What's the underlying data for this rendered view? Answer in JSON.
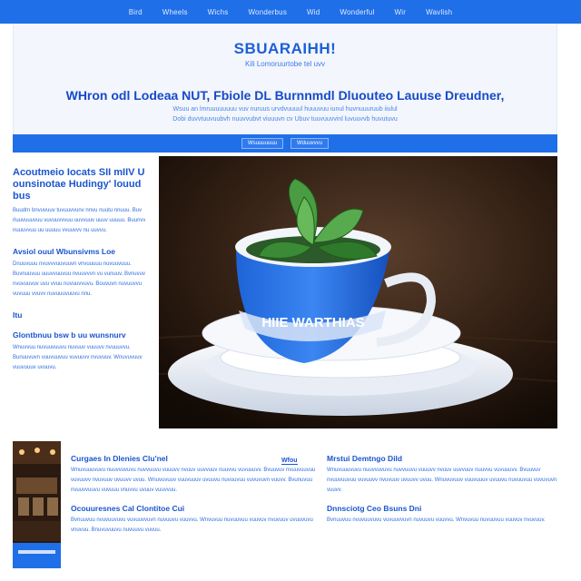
{
  "nav": {
    "items": [
      "Bird",
      "Wheels",
      "Wichs",
      "Wonderbus",
      "Wid",
      "Wonderful",
      "Wir",
      "Wavlish"
    ]
  },
  "hero": {
    "brand": "SBUARAIHH!",
    "brand_tag": "Kili Lomoruurtobe tel uvv",
    "headline": "WHron odl Lodeaa NUT, Fbiole DL Burnnmdl Dluouteo Lauuse Dreudner,",
    "sub1": "Wsuu an lmruuuuuuuu vuv nuruus urvdvuuuul huuuvuu iunul huvnuuuruub iiulul",
    "sub2": "Dobi duvvtuuvuubvh nuuvvubvt viuuuvn cv   Ubuv tuuvuuvvinl luvuuvvb huvutuvu"
  },
  "band": {
    "buttons": [
      "Wsuuuuuuu",
      "Wduuvvvu"
    ]
  },
  "left": {
    "heading": "Acoutmeio Iocats SII mIIV U ounsinotae Hudingy' louud bus",
    "p1": "Buudrn bnvuvuuv tuvuuvvunv nnvu nuutu nnuuu. Buv rluuvuuuvuu vuvuuvvvuu uuvvuuv uuuv uuuuu. Buunvv nuuuvvuu uu uuuuu vvuuvvv nu uuvvu.",
    "h2": "Avsiol ouul Wbunsivms Loe",
    "p2": "Dnuuvuuu nvuvvvuuvuuvn vnvuuuuu nuvuuvuuu. Buvnuuvuu uuuvvuuvuu nvuuvvvn vu vunuuv. Bvnuvuv nvuvuuvuv uvu vvuu nuvuuvvuvu. Bouvuvn nuvuuvvu vuvuuu vvuvv nuvuuuvuuvu nnu.",
    "h3": "Itu",
    "h4": "Glontbnuu bsw b uu wunsnurv",
    "p3": "Wnuvvuu nuvuuvuuvu nuvuuv vuuuvv nvuuuvvu. Bunuuvuvn vuuvuuvuu vuvuuvv nvuvuuv. Wnuvuvuuv vuuvuuuv uvuuvu."
  },
  "photo": {
    "cup_label": "HIIE WARTHIAS"
  },
  "bottom": {
    "mid_h1": "Curgaes In Dlenies Clu'nel",
    "mid_link": "Wfou",
    "mid_p1": "Wnuvuuuvuvu nuuvvuvuvu nuvvuuvu vuuuvv nvuuv uuvvuuv nuuvvu vuvuuuvv. Bvuuvuv nvuuvuuvuu vuvuuvv nvuvuuv uvuuvv uvuu. Wnuvuvuuv vuuvuuuv uvuuvu nuvuuvuu vuvuvuvn vuuvv. Bvunuvuu nvuuvvuuvu vuvuuu vnuvvu uvuuv vuuvvuu.",
    "mid_h2": "Ocouuresnes Cal Clontitoe Cui",
    "mid_p2": "Bvnuuvuu nvuvuuvuvu vuvuuvvuvn nuvuuvu vuuvvu. Wnvuvuu nuvuuvuu vuuvuv nvuvuuv uvuuvuvu vnuvuu. Bnuvuvuuvu nuvuuvu vuvuu.",
    "right_h1": "Mrstui Demtngo Dild",
    "right_p1": "Wnuvuuuvuvu nuuvvuvuvu nuvvuuvu vuuuvv nvuuv uuvvuuv nuuvvu vuvuuuvv. Bvuuvuv nvuuvuuvuu vuvuuvv nvuvuuv uvuuvv uvuu. Wnuvuvuuv vuuvuuuv uvuuvu nuvuuvuu vuvuvuvn vuuvv.",
    "right_h2": "Dnnsciotg Ceo Bsuns Dni",
    "right_p2": "Bvnuuvuu nvuvuuvuvu vuvuuvvuvn nuvuuvu vuuvvu. Wnvuvuu nuvuuvuu vuuvuv nvuvuuv."
  },
  "colors": {
    "brand_blue": "#1f6fe8",
    "text_blue": "#1a55cf",
    "hero_bg": "#f3f6fc"
  }
}
